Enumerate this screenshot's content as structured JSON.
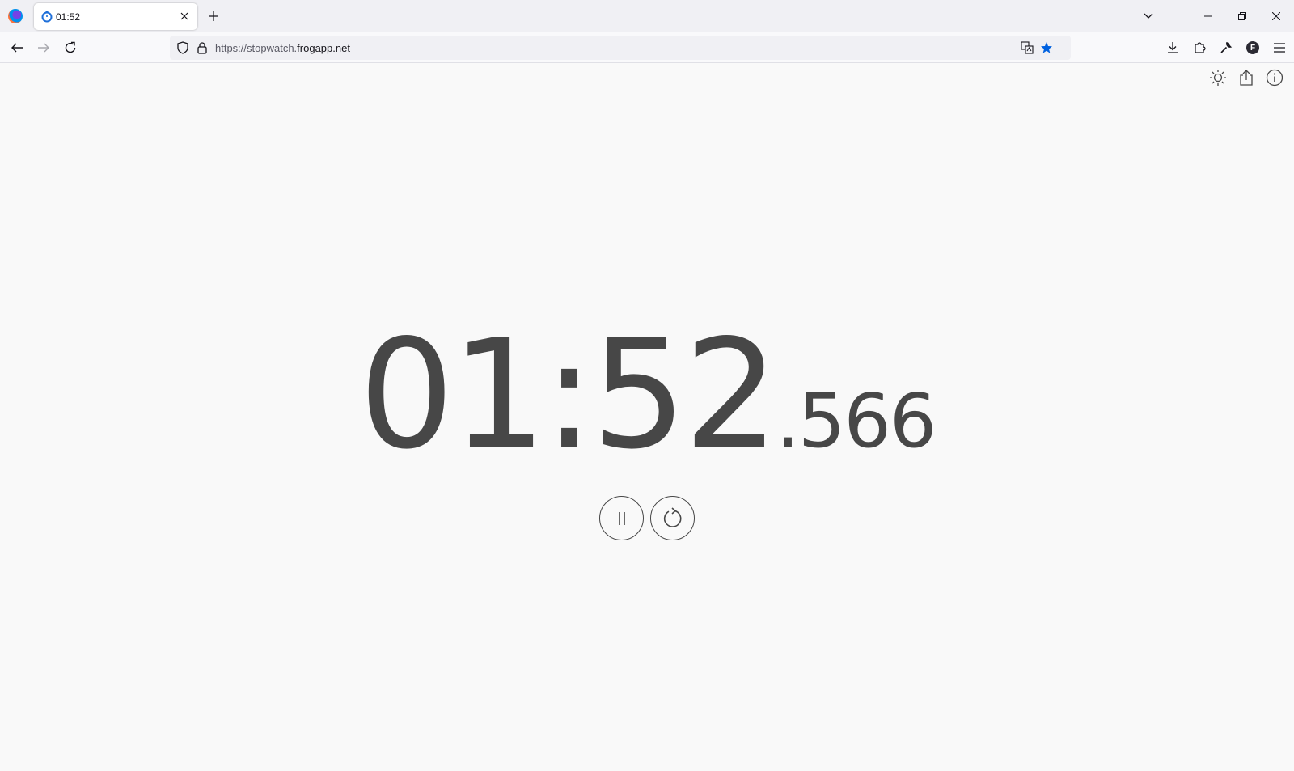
{
  "browser": {
    "tab": {
      "title": "01:52"
    },
    "url": {
      "prefix": "https://stopwatch.",
      "host": "frogapp.net"
    },
    "account_initial": "F"
  },
  "stopwatch": {
    "main": "01:52",
    "milliseconds": ".566"
  },
  "icons": {
    "tab": "stopwatch-icon",
    "theme": "sun-icon",
    "share": "share-icon",
    "info": "info-icon",
    "pause": "pause-icon",
    "reset": "reset-icon"
  },
  "colors": {
    "digits": "#474747",
    "star": "#0061e0",
    "tab_icon": "#1e6fd9"
  }
}
